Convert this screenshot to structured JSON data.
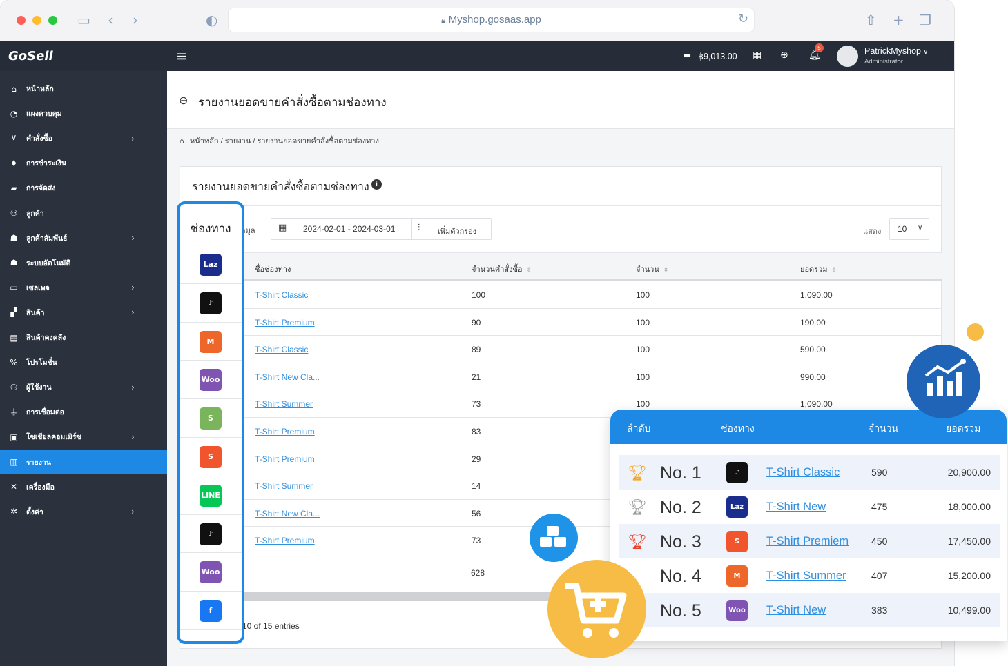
{
  "browser": {
    "url": "Myshop.gosaas.app"
  },
  "topbar": {
    "logo": "GoSell",
    "balance": "฿9,013.00",
    "notif_count": "5",
    "user_name": "PatrickMyshop",
    "user_role": "Administrator"
  },
  "sidebar": {
    "items": [
      {
        "label": "หน้าหลัก",
        "icon": "home-icon",
        "arrow": false
      },
      {
        "label": "แผงควบคุม",
        "icon": "dashboard-icon",
        "arrow": false
      },
      {
        "label": "คำสั่งซื้อ",
        "icon": "cart-icon",
        "arrow": true
      },
      {
        "label": "การชำระเงิน",
        "icon": "money-bag-icon",
        "arrow": false
      },
      {
        "label": "การจัดส่ง",
        "icon": "truck-icon",
        "arrow": false
      },
      {
        "label": "ลูกค้า",
        "icon": "users-icon",
        "arrow": false
      },
      {
        "label": "ลูกค้าสัมพันธ์",
        "icon": "user-tie-icon",
        "arrow": true
      },
      {
        "label": "ระบบอัตโนมัติ",
        "icon": "automation-icon",
        "arrow": false
      },
      {
        "label": "เซลเพจ",
        "icon": "window-icon",
        "arrow": true
      },
      {
        "label": "สินค้า",
        "icon": "boxes-icon",
        "arrow": true
      },
      {
        "label": "สินค้าคงคลัง",
        "icon": "warehouse-icon",
        "arrow": false
      },
      {
        "label": "โปรโมชั่น",
        "icon": "percent-icon",
        "arrow": false
      },
      {
        "label": "ผู้ใช้งาน",
        "icon": "user-group-icon",
        "arrow": true
      },
      {
        "label": "การเชื่อมต่อ",
        "icon": "plug-icon",
        "arrow": false
      },
      {
        "label": "โซเชียลคอมเมิร์ซ",
        "icon": "social-icon",
        "arrow": true
      },
      {
        "label": "รายงาน",
        "icon": "chart-icon",
        "arrow": false,
        "active": true
      },
      {
        "label": "เครื่องมือ",
        "icon": "tools-icon",
        "arrow": false
      },
      {
        "label": "ตั้งค่า",
        "icon": "gear-icon",
        "arrow": true
      }
    ]
  },
  "page": {
    "title": "รายงานยอดขายคำสั่งซื้อตามช่องทาง",
    "breadcrumb": "หน้าหลัก / รายงาน / รายงานยอดขายคำสั่งซื้อตามช่องทาง"
  },
  "card": {
    "title": "รายงานยอดขายคำสั่งซื้อตามช่องทาง",
    "filter_label": "อมูล",
    "date_range": "2024-02-01 - 2024-03-01",
    "add_filter": "เพิ่มตัวกรอง",
    "show_label": "แสดง",
    "page_size": "10"
  },
  "table": {
    "headers": [
      "ชื่อช่องทาง",
      "จำนวนคำสั่งซื้อ",
      "จำนวน",
      "ยอดรวม"
    ],
    "rows": [
      {
        "name": "T-Shirt Classic",
        "orders": "100",
        "qty": "100",
        "total": "1,090.00"
      },
      {
        "name": "T-Shirt Premium",
        "orders": "90",
        "qty": "100",
        "total": "190.00"
      },
      {
        "name": "T-Shirt Classic",
        "orders": "89",
        "qty": "100",
        "total": "590.00"
      },
      {
        "name": "T-Shirt New Cla...",
        "orders": "21",
        "qty": "100",
        "total": "990.00"
      },
      {
        "name": "T-Shirt Summer",
        "orders": "73",
        "qty": "100",
        "total": "1,090.00"
      },
      {
        "name": "T-Shirt Premium",
        "orders": "83",
        "qty": "",
        "total": ""
      },
      {
        "name": "T-Shirt Premium",
        "orders": "29",
        "qty": "",
        "total": ""
      },
      {
        "name": "T-Shirt Summer",
        "orders": "14",
        "qty": "",
        "total": ""
      },
      {
        "name": "T-Shirt New Cla...",
        "orders": "56",
        "qty": "",
        "total": ""
      },
      {
        "name": "T-Shirt Premium",
        "orders": "73",
        "qty": "",
        "total": ""
      }
    ],
    "footer_orders": "628",
    "entries": "10 of 15 entries"
  },
  "channels": {
    "title": "ช่องทาง",
    "items": [
      {
        "name": "lazada",
        "short": "Laz",
        "color": "#1a2c8c"
      },
      {
        "name": "tiktok",
        "short": "♪",
        "color": "#111111"
      },
      {
        "name": "magento",
        "short": "M",
        "color": "#ee672a"
      },
      {
        "name": "woocommerce",
        "short": "Woo",
        "color": "#7f54b3"
      },
      {
        "name": "shopify",
        "short": "S",
        "color": "#7ab55c"
      },
      {
        "name": "shopee",
        "short": "S",
        "color": "#f0552d"
      },
      {
        "name": "line",
        "short": "LINE",
        "color": "#06c755"
      },
      {
        "name": "tiktok",
        "short": "♪",
        "color": "#111111"
      },
      {
        "name": "woocommerce",
        "short": "Woo",
        "color": "#7f54b3"
      },
      {
        "name": "facebook",
        "short": "f",
        "color": "#1877f2"
      }
    ]
  },
  "top_channels": {
    "headers": [
      "ลำดับ",
      "ช่องทาง",
      "จำนวน",
      "ยอดรวม"
    ],
    "rows": [
      {
        "rank": "No. 1",
        "trophy": "gold",
        "channel": "tiktok",
        "short": "♪",
        "color": "#111111",
        "name": "T-Shirt Classic",
        "qty": "590",
        "total": "20,900.00"
      },
      {
        "rank": "No. 2",
        "trophy": "silver",
        "channel": "lazada",
        "short": "Laz",
        "color": "#1a2c8c",
        "name": "T-Shirt New",
        "qty": "475",
        "total": "18,000.00"
      },
      {
        "rank": "No. 3",
        "trophy": "bronze",
        "channel": "shopee",
        "short": "S",
        "color": "#f0552d",
        "name": "T-Shirt Premiem",
        "qty": "450",
        "total": "17,450.00"
      },
      {
        "rank": "No. 4",
        "trophy": "none",
        "channel": "magento",
        "short": "M",
        "color": "#ee672a",
        "name": "T-Shirt Summer",
        "qty": "407",
        "total": "15,200.00"
      },
      {
        "rank": "No. 5",
        "trophy": "none",
        "channel": "woocommerce",
        "short": "Woo",
        "color": "#7f54b3",
        "name": "T-Shirt New",
        "qty": "383",
        "total": "10,499.00"
      }
    ]
  },
  "colors": {
    "accent": "#1e88e5",
    "sidebar": "#2b323e",
    "topbar": "#262d38",
    "gold": "#f6a623",
    "silver": "#9a9a9a",
    "bronze": "#e8432f",
    "yellow": "#f6bc45",
    "dark_blue": "#1f64b6"
  }
}
